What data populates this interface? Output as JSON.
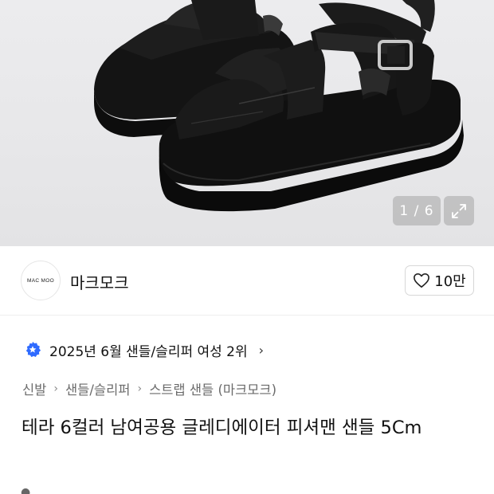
{
  "image_gallery": {
    "counter": "1 / 6",
    "expand_icon": "expand-arrows-icon",
    "background_color": "#e8e8ea"
  },
  "brand": {
    "logo_text": "MAC MOO",
    "name": "마크모크"
  },
  "like": {
    "icon": "heart-outline-icon",
    "count": "10만"
  },
  "ranking": {
    "badge_icon": "star-badge-icon",
    "badge_color": "#2f6bff",
    "text": "2025년 6월 샌들/슬리퍼 여성 2위",
    "chevron": "›"
  },
  "breadcrumb": {
    "items": [
      "신발",
      "샌들/슬리퍼",
      "스트랩 샌들 (마크모크)"
    ],
    "separator": "›"
  },
  "product": {
    "title": "테라 6컬러 남여공용 글레디에이터 피셔맨 샌들 5Cm"
  }
}
